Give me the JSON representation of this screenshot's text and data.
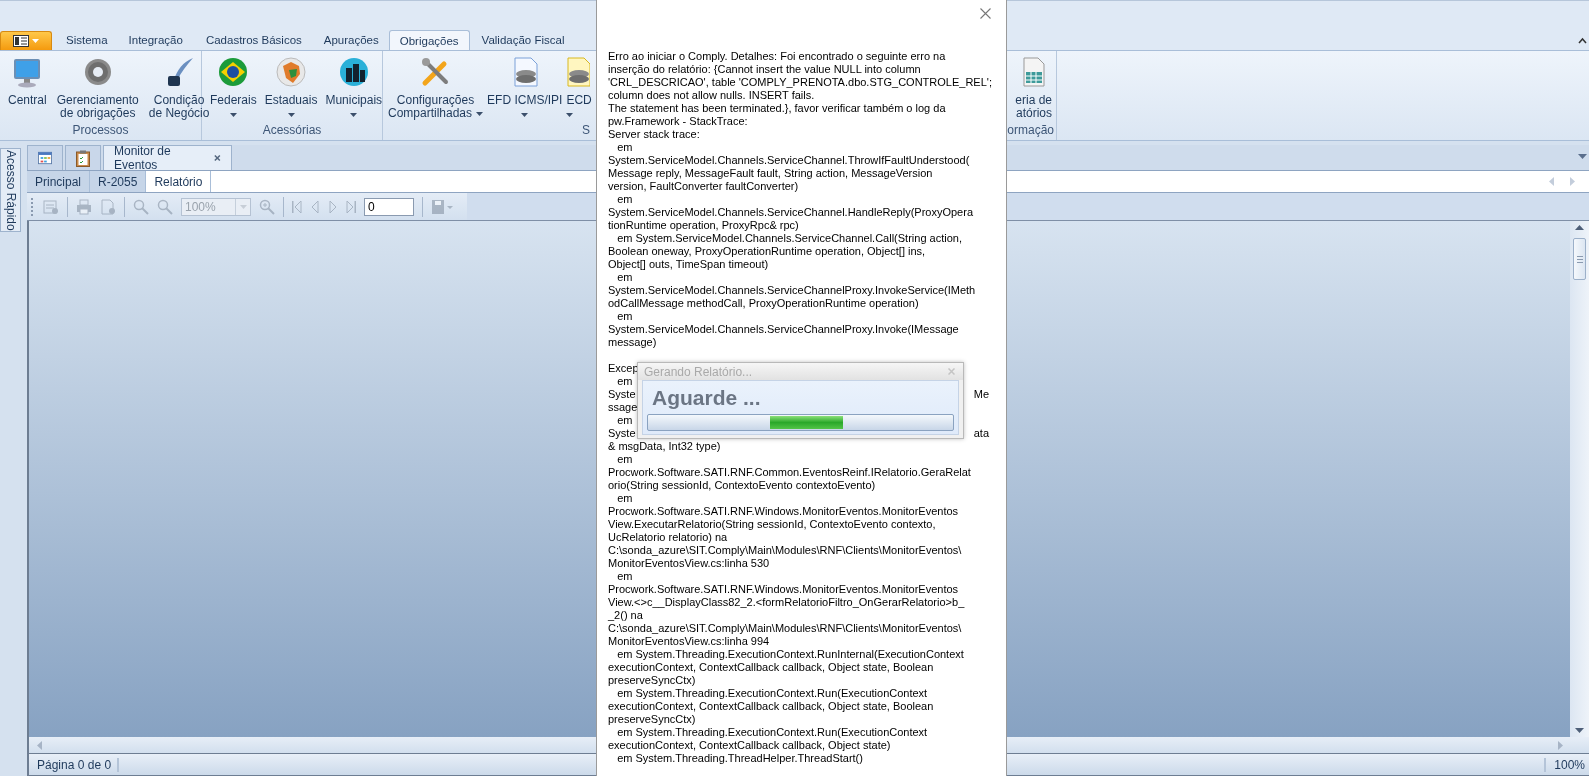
{
  "ribbon": {
    "tabs": [
      {
        "label": "Sistema",
        "selected": false
      },
      {
        "label": "Integração",
        "selected": false
      },
      {
        "label": "Cadastros Básicos",
        "selected": false
      },
      {
        "label": "Apurações",
        "selected": false
      },
      {
        "label": "Obrigações",
        "selected": true
      },
      {
        "label": "Validação Fiscal",
        "selected": false
      }
    ],
    "groups": [
      {
        "label": "Processos",
        "buttons": [
          {
            "lines": [
              "Central"
            ],
            "dropdown": false
          },
          {
            "lines": [
              "Gerenciamento",
              "de obrigações"
            ],
            "dropdown": false
          },
          {
            "lines": [
              "Condição",
              "de Negócio"
            ],
            "dropdown": false
          }
        ]
      },
      {
        "label": "Acessórias",
        "buttons": [
          {
            "lines": [
              "Federais"
            ],
            "dropdown": true
          },
          {
            "lines": [
              "Estaduais"
            ],
            "dropdown": true
          },
          {
            "lines": [
              "Municipais"
            ],
            "dropdown": true
          }
        ]
      },
      {
        "label": "S",
        "buttons": [
          {
            "lines": [
              "Configurações",
              "Compartilhadas"
            ],
            "dropdown": true
          },
          {
            "lines": [
              "EFD ICMS/IPI"
            ],
            "dropdown": true
          },
          {
            "lines": [
              "ECD"
            ],
            "dropdown": true
          }
        ]
      },
      {
        "label": "ormação",
        "buttons": [
          {
            "lines": [
              "eria de",
              "atórios"
            ],
            "dropdown": false
          }
        ]
      }
    ]
  },
  "side_panel": {
    "label": "Acesso Rápido"
  },
  "document_tabs": [
    {
      "kind": "icon",
      "selected": false
    },
    {
      "kind": "icon",
      "selected": false
    },
    {
      "kind": "text",
      "label": "Monitor de Eventos",
      "closable": true,
      "selected": true
    }
  ],
  "sub_tabs": [
    {
      "label": "Principal",
      "selected": false
    },
    {
      "label": "R-2055",
      "selected": false
    },
    {
      "label": "Relatório",
      "selected": true
    }
  ],
  "toolbar": {
    "disabled": true,
    "zoom": "100%",
    "page": "0"
  },
  "status_bar": {
    "page": "Página 0 de 0",
    "zoom": "100%"
  },
  "error_dialog": {
    "message_lines": [
      {
        "text": "Erro ao iniciar o Comply. Detalhes: Foi encontrado o seguinte erro na"
      },
      {
        "text": "inserção do relatório: {Cannot insert the value NULL into column"
      },
      {
        "text": "'CRL_DESCRICAO', table 'COMPLY_PRENOTA.dbo.STG_CONTROLE_REL';"
      },
      {
        "text": "column does not allow nulls. INSERT fails."
      },
      {
        "text": "The statement has been terminated.}, favor verificar também o log da"
      },
      {
        "text": "pw.Framework - StackTrace:"
      },
      {
        "text": "Server stack trace:"
      },
      {
        "text": "   em"
      },
      {
        "text": "System.ServiceModel.Channels.ServiceChannel.ThrowIfFaultUnderstood("
      },
      {
        "text": "Message reply, MessageFault fault, String action, MessageVersion"
      },
      {
        "text": "version, FaultConverter faultConverter)"
      },
      {
        "text": "   em"
      },
      {
        "text": "System.ServiceModel.Channels.ServiceChannel.HandleReply(ProxyOpera"
      },
      {
        "text": "tionRuntime operation, ProxyRpc& rpc)"
      },
      {
        "text": "   em System.ServiceModel.Channels.ServiceChannel.Call(String action,"
      },
      {
        "text": "Boolean oneway, ProxyOperationRuntime operation, Object[] ins,"
      },
      {
        "text": "Object[] outs, TimeSpan timeout)"
      },
      {
        "text": "   em"
      },
      {
        "text": "System.ServiceModel.Channels.ServiceChannelProxy.InvokeService(IMeth"
      },
      {
        "text": "odCallMessage methodCall, ProxyOperationRuntime operation)"
      },
      {
        "text": "   em"
      },
      {
        "text": "System.ServiceModel.Channels.ServiceChannelProxy.Invoke(IMessage"
      },
      {
        "text": "message)"
      }
    ],
    "exception_lines": [
      {
        "text": "Excep"
      },
      {
        "text": "   em"
      },
      {
        "text": "Syste",
        "right": "Me"
      },
      {
        "text": "ssage"
      },
      {
        "text": "   em"
      },
      {
        "text": "Syste",
        "right": "ata"
      },
      {
        "text": "& msgData, Int32 type)"
      },
      {
        "text": "   em"
      },
      {
        "text": "Procwork.Software.SATI.RNF.Common.EventosReinf.IRelatorio.GeraRelat"
      },
      {
        "text": "orio(String sessionId, ContextoEvento contextoEvento)"
      },
      {
        "text": "   em"
      },
      {
        "text": "Procwork.Software.SATI.RNF.Windows.MonitorEventos.MonitorEventos"
      },
      {
        "text": "View.ExecutarRelatorio(String sessionId, ContextoEvento contexto,"
      },
      {
        "text": "UcRelatorio relatorio) na"
      },
      {
        "text": "C:\\sonda_azure\\SIT.Comply\\Main\\Modules\\RNF\\Clients\\MonitorEventos\\"
      },
      {
        "text": "MonitorEventosView.cs:linha 530"
      },
      {
        "text": "   em"
      },
      {
        "text": "Procwork.Software.SATI.RNF.Windows.MonitorEventos.MonitorEventos"
      },
      {
        "text": "View.<>c__DisplayClass82_2.<formRelatorioFiltro_OnGerarRelatorio>b_"
      },
      {
        "text": "_2() na"
      },
      {
        "text": "C:\\sonda_azure\\SIT.Comply\\Main\\Modules\\RNF\\Clients\\MonitorEventos\\"
      },
      {
        "text": "MonitorEventosView.cs:linha 994"
      },
      {
        "text": "   em System.Threading.ExecutionContext.RunInternal(ExecutionContext"
      },
      {
        "text": "executionContext, ContextCallback callback, Object state, Boolean"
      },
      {
        "text": "preserveSyncCtx)"
      },
      {
        "text": "   em System.Threading.ExecutionContext.Run(ExecutionContext"
      },
      {
        "text": "executionContext, ContextCallback callback, Object state, Boolean"
      },
      {
        "text": "preserveSyncCtx)"
      },
      {
        "text": "   em System.Threading.ExecutionContext.Run(ExecutionContext"
      },
      {
        "text": "executionContext, ContextCallback callback, Object state)"
      },
      {
        "text": "   em System.Threading.ThreadHelper.ThreadStart()"
      }
    ]
  },
  "progress_dialog": {
    "title": "Gerando Relatório...",
    "message": "Aguarde ..."
  }
}
